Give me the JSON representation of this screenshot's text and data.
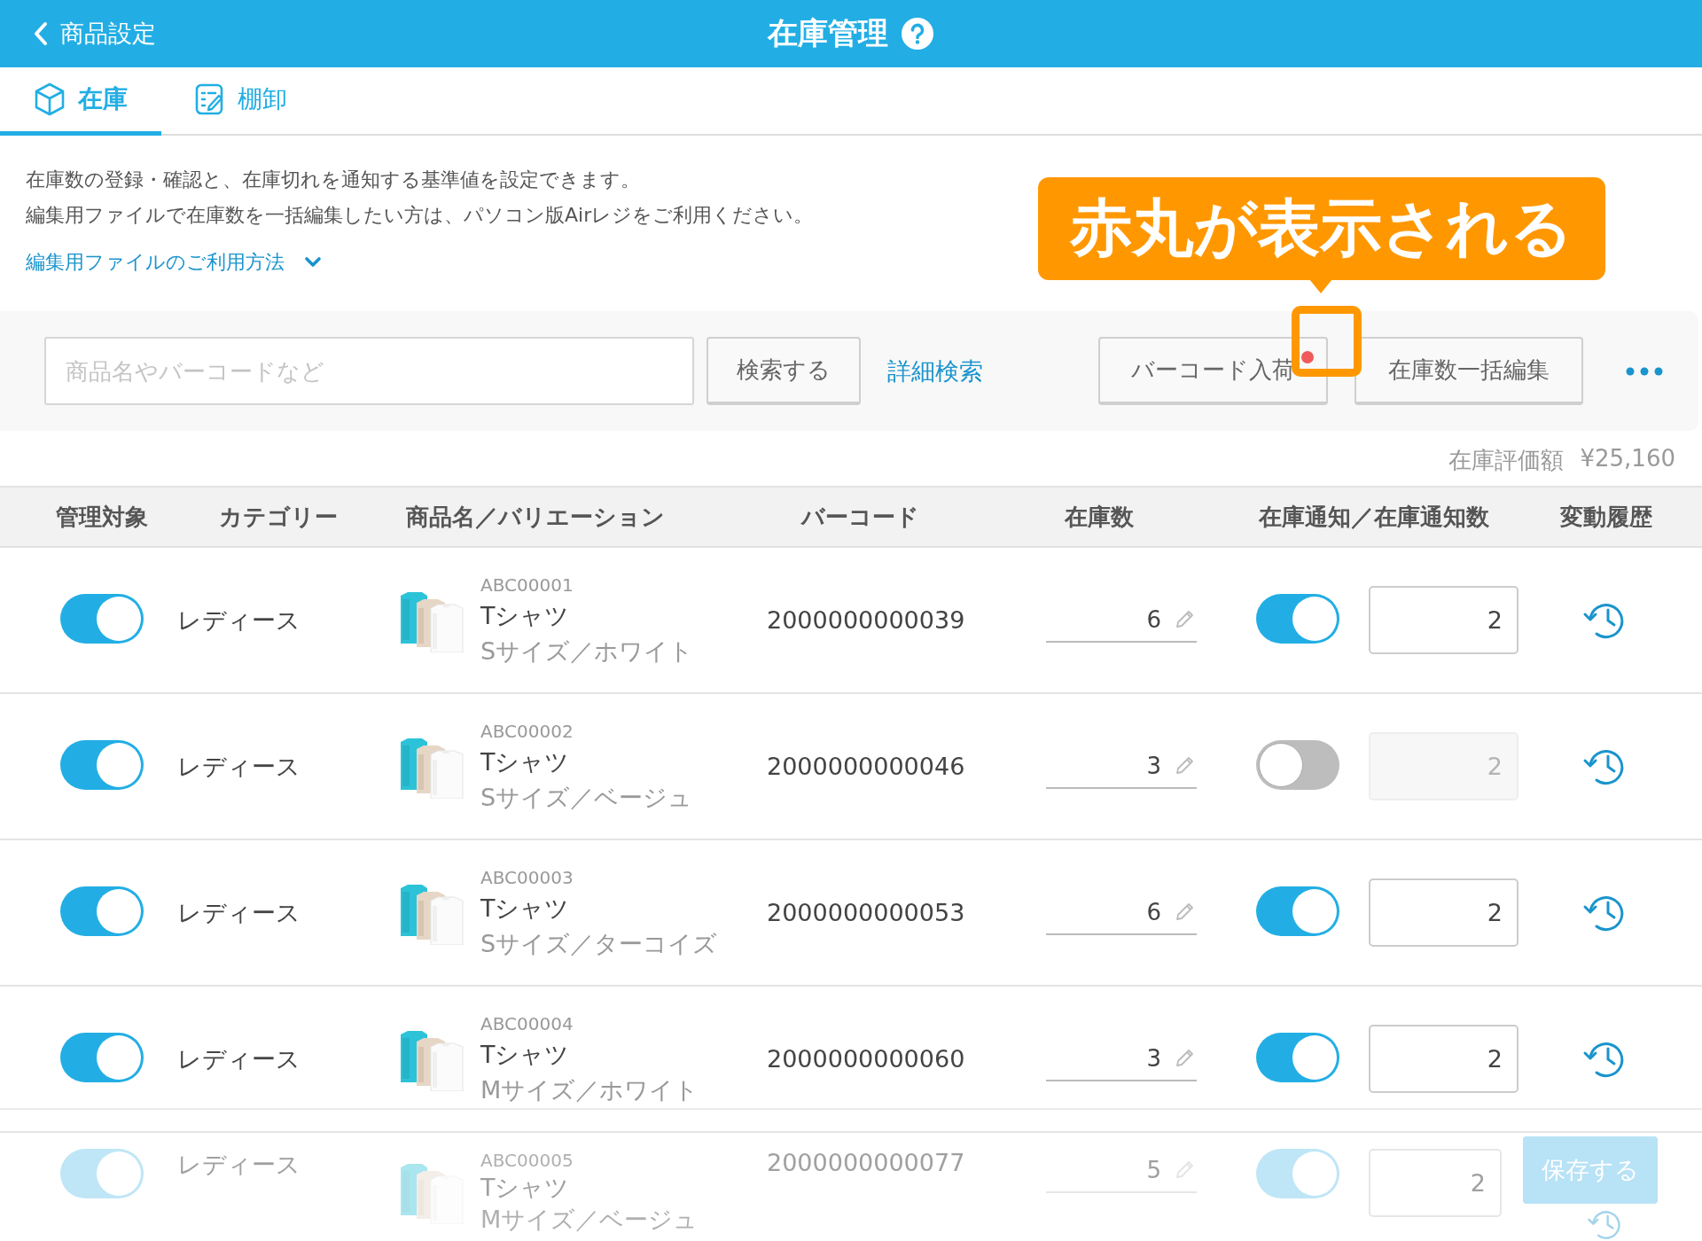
{
  "header": {
    "back_label": "商品設定",
    "title": "在庫管理"
  },
  "tabs": [
    {
      "label": "在庫",
      "selected": true
    },
    {
      "label": "棚卸",
      "selected": false
    }
  ],
  "intro": {
    "lines": [
      "在庫数の登録・確認と、在庫切れを通知する基準値を設定できます。",
      "編集用ファイルで在庫数を一括編集したい方は、パソコン版Airレジをご利用ください。"
    ],
    "link": "編集用ファイルのご利用方法",
    "expanded": false
  },
  "toolbar": {
    "search_placeholder": "商品名やバーコードなど",
    "search_button": "検索する",
    "advanced_link": "詳細検索",
    "barcode_button": "バーコード入荷",
    "barcode_badge": true,
    "bulk_button": "在庫数一括編集"
  },
  "annotation": {
    "text": "赤丸が表示される"
  },
  "total": {
    "label": "在庫評価額",
    "value": "¥25,160"
  },
  "table": {
    "columns": [
      "管理対象",
      "カテゴリー",
      "商品名／バリエーション",
      "バーコード",
      "在庫数",
      "在庫通知／在庫通知数",
      "変動履歴"
    ],
    "rows": [
      {
        "managed": true,
        "category": "レディース",
        "code": "ABC00001",
        "name": "Tシャツ",
        "variation": "Sサイズ／ホワイト",
        "barcode": "2000000000039",
        "stock": "6",
        "notify": true,
        "notify_count": "2"
      },
      {
        "managed": true,
        "category": "レディース",
        "code": "ABC00002",
        "name": "Tシャツ",
        "variation": "Sサイズ／ベージュ",
        "barcode": "2000000000046",
        "stock": "3",
        "notify": false,
        "notify_count": "2"
      },
      {
        "managed": true,
        "category": "レディース",
        "code": "ABC00003",
        "name": "Tシャツ",
        "variation": "Sサイズ／ターコイズ",
        "barcode": "2000000000053",
        "stock": "6",
        "notify": true,
        "notify_count": "2"
      },
      {
        "managed": true,
        "category": "レディース",
        "code": "ABC00004",
        "name": "Tシャツ",
        "variation": "Mサイズ／ホワイト",
        "barcode": "2000000000060",
        "stock": "3",
        "notify": true,
        "notify_count": "2"
      },
      {
        "managed": true,
        "category": "レディース",
        "code": "ABC00005",
        "name": "Tシャツ",
        "variation": "Mサイズ／ベージュ",
        "barcode": "2000000000077",
        "stock": "5",
        "notify": true,
        "notify_count": "2"
      }
    ]
  },
  "footer": {
    "save_button": "保存する",
    "disabled": true
  }
}
